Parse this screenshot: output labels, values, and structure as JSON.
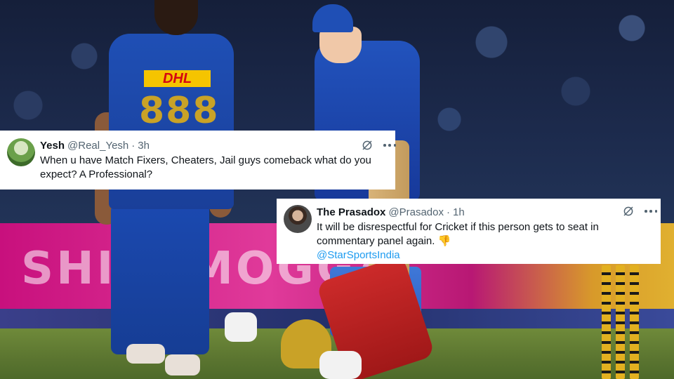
{
  "background": {
    "board_text": "SHIVAMOGGA",
    "jersey_sponsor": "DHL",
    "jersey_number": "888"
  },
  "tweets": [
    {
      "name": "Yesh",
      "handle": "@Real_Yesh",
      "separator": "·",
      "time": "3h",
      "text": "When u have Match Fixers, Cheaters, Jail guys comeback what do you expect? A Professional?",
      "mention": ""
    },
    {
      "name": "The Prasadox",
      "handle": "@Prasadox",
      "separator": "·",
      "time": "1h",
      "text": "It will be disrespectful for Cricket if this person gets to seat in commentary panel again.",
      "emoji": "👎",
      "mention": "@StarSportsIndia"
    }
  ],
  "colors": {
    "link": "#1d9bf0",
    "secondary_text": "#536471",
    "primary_text": "#0f1419",
    "card_bg": "#ffffff"
  },
  "icons": [
    "grok-icon",
    "more-options-icon"
  ]
}
